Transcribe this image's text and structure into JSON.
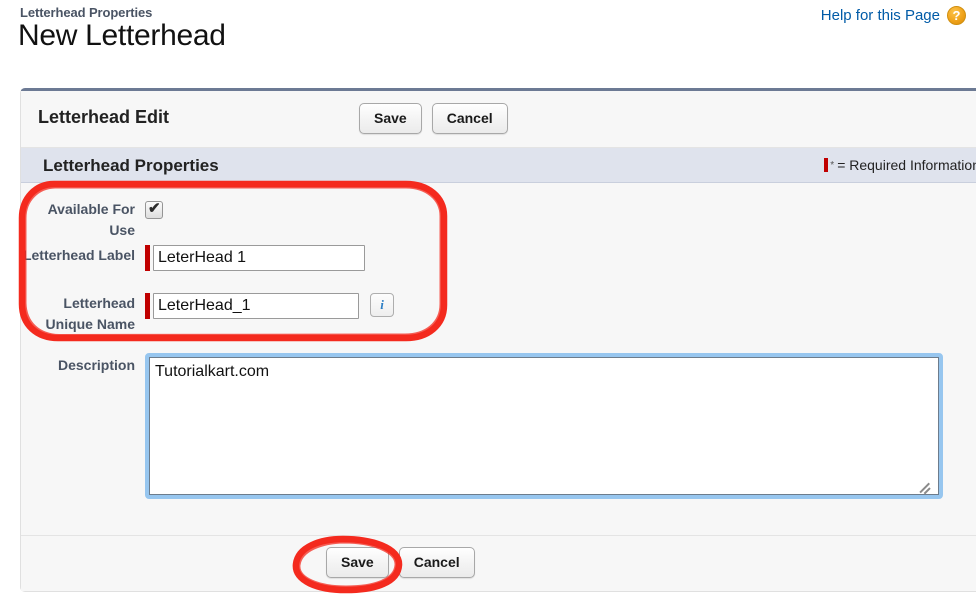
{
  "header": {
    "breadcrumb": "Letterhead Properties",
    "title": "New Letterhead",
    "help_link": "Help for this Page",
    "help_icon": "question-mark-circle-icon"
  },
  "edit_bar": {
    "title": "Letterhead Edit",
    "save_label": "Save",
    "cancel_label": "Cancel"
  },
  "section": {
    "title": "Letterhead Properties",
    "required_legend": "= Required Information",
    "required_marker_color": "#c00000"
  },
  "fields": {
    "available_for_use": {
      "label": "Available For Use",
      "checked": true,
      "required": false
    },
    "letterhead_label": {
      "label": "Letterhead Label",
      "value": "LeterHead 1",
      "required": true
    },
    "letterhead_unique_name": {
      "label": "Letterhead Unique Name",
      "value": "LeterHead_1",
      "required": true,
      "info_icon": "info-icon"
    },
    "description": {
      "label": "Description",
      "value": "Tutorialkart.com",
      "required": false,
      "focused": true
    }
  },
  "footer": {
    "save_label": "Save",
    "cancel_label": "Cancel"
  },
  "annotations": {
    "color": "#f42a1e",
    "shapes": [
      {
        "name": "fields-group-highlight"
      },
      {
        "name": "save-button-highlight"
      }
    ]
  }
}
